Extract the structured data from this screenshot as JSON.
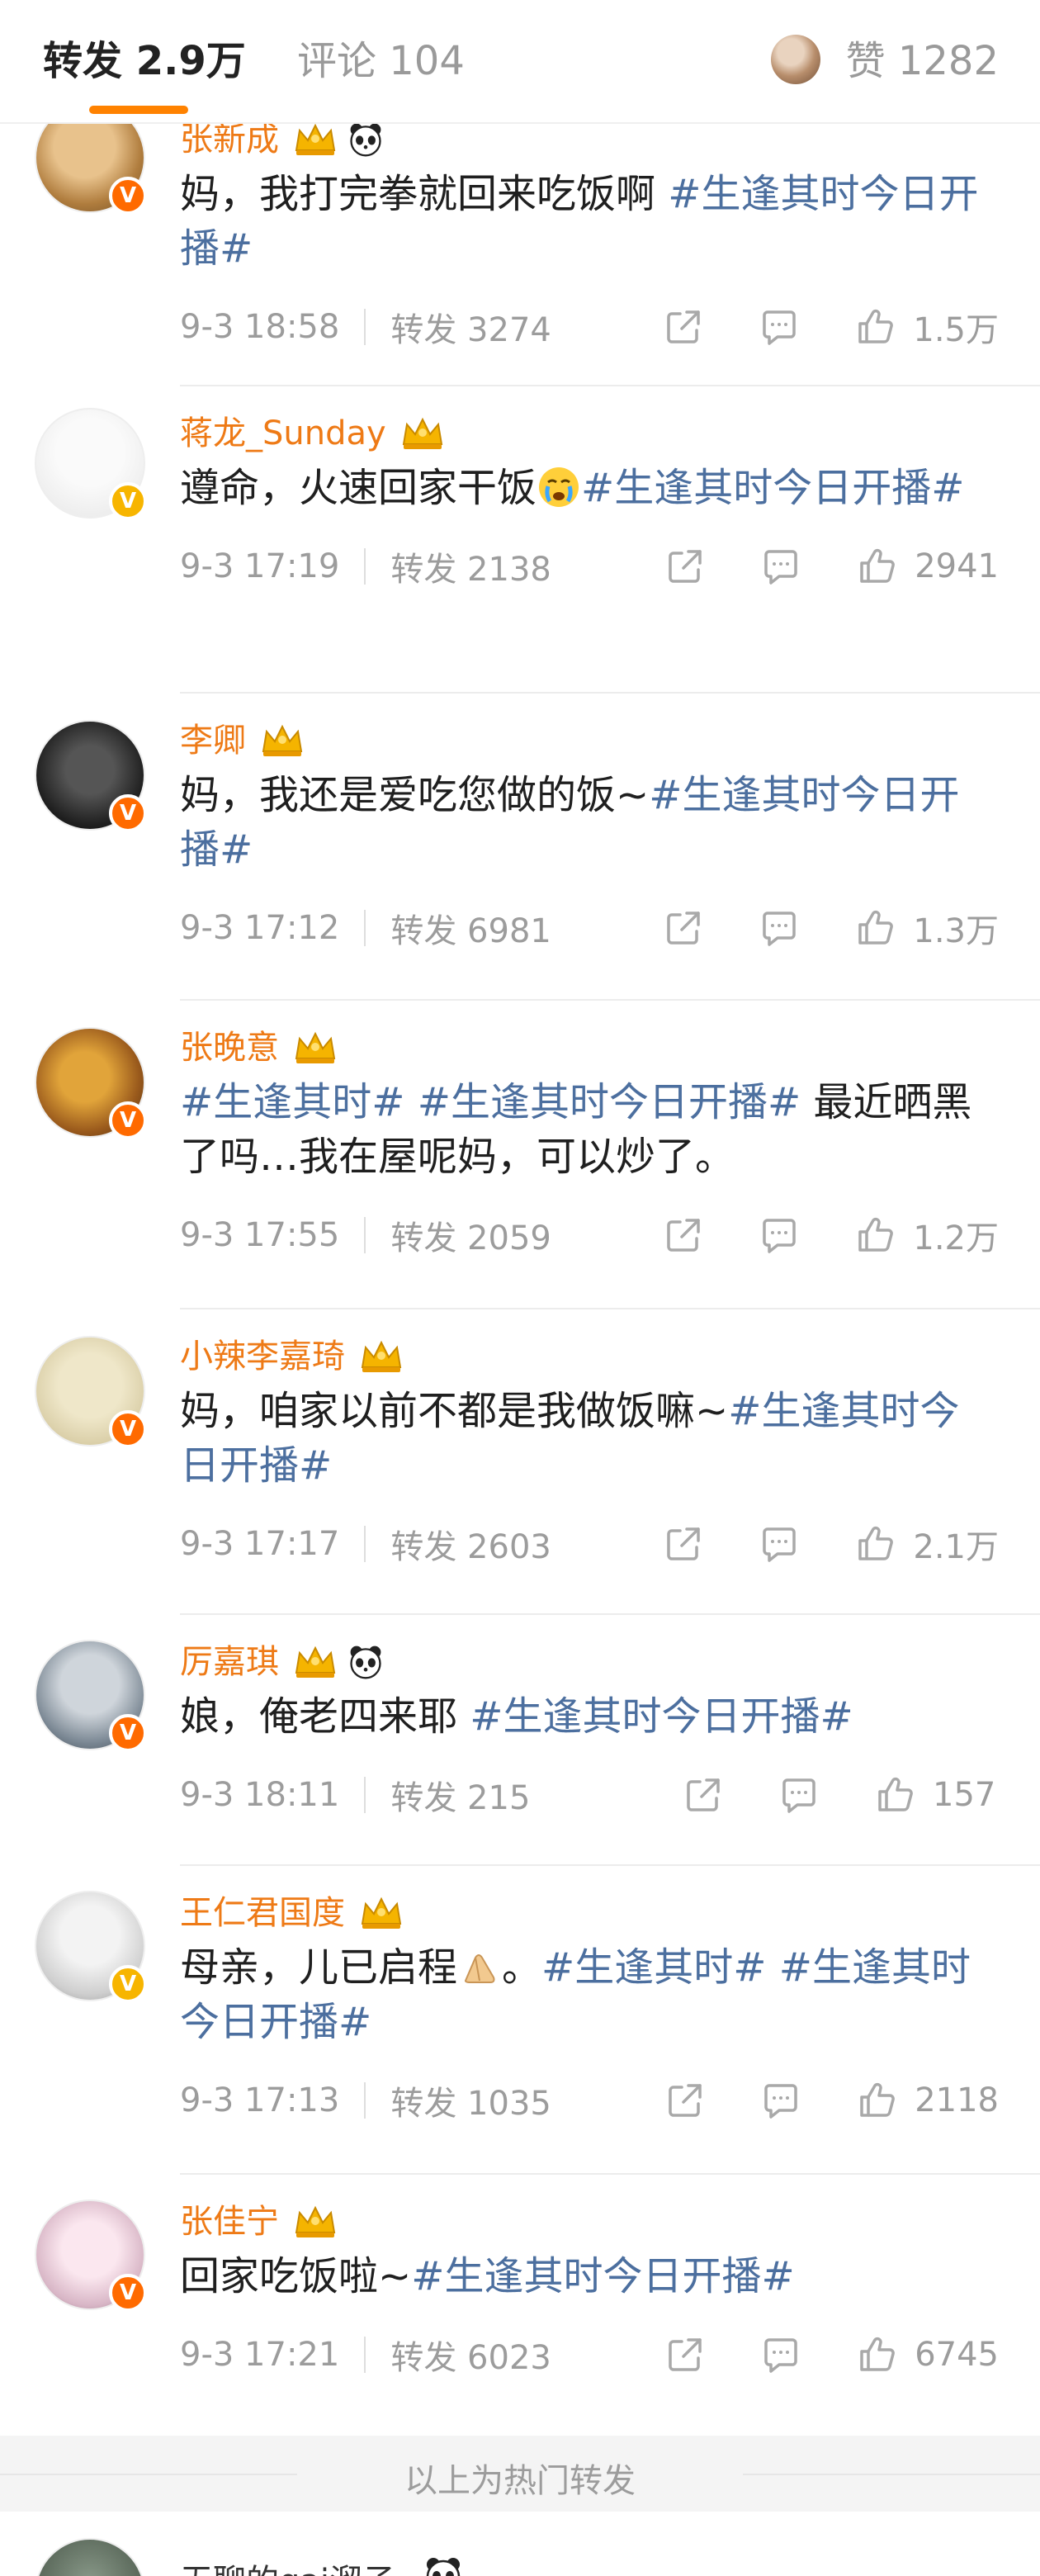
{
  "tabs": {
    "repost": "转发 2.9万",
    "comments": "评论 104",
    "likes": "赞 1282"
  },
  "posts": [
    {
      "name": "张新成",
      "badge": "V",
      "crown": "♛",
      "panda": true,
      "text": "妈，我打完拳就回来吃饭啊 ",
      "tags": [
        "#生逢其时今日开播#"
      ],
      "time": "9-3 18:58",
      "reposts": "转发 3274",
      "likes": "1.5万"
    },
    {
      "name": "蒋龙_Sunday",
      "badge": "V",
      "crown": "♛",
      "panda": false,
      "text": "遵命，火速回家干饭",
      "emoji": "crying-face",
      "tags": [
        "#生逢其时今日开播#"
      ],
      "time": "9-3 17:19",
      "reposts": "转发 2138",
      "likes": "2941"
    },
    {
      "name": "李卿",
      "badge": "V",
      "crown": "♛",
      "panda": false,
      "text": "妈，我还是爱吃您做的饭~",
      "tags": [
        "#生逢其时今日开播#"
      ],
      "time": "9-3 17:12",
      "reposts": "转发 6981",
      "likes": "1.3万"
    },
    {
      "name": "张晚意",
      "badge": "V",
      "crown": "♛",
      "panda": false,
      "text_pre_tags": [
        "#生逢其时#",
        "#生逢其时今日开播#"
      ],
      "text": " 最近晒黑了吗…我在屋呢妈，可以炒了。",
      "time": "9-3 17:55",
      "reposts": "转发 2059",
      "likes": "1.2万"
    },
    {
      "name": "小辣李嘉琦",
      "badge": "V",
      "crown": "♛",
      "panda": false,
      "text": "妈，咱家以前不都是我做饭嘛~",
      "tags": [
        "#生逢其时今日开播#"
      ],
      "time": "9-3 17:17",
      "reposts": "转发 2603",
      "likes": "2.1万"
    },
    {
      "name": "厉嘉琪",
      "badge": "V",
      "crown": "♛",
      "panda": true,
      "text": "娘，俺老四来耶 ",
      "tags": [
        "#生逢其时今日开播#"
      ],
      "time": "9-3 18:11",
      "reposts": "转发 215",
      "likes": "157"
    },
    {
      "name": "王仁君国度",
      "badge": "V",
      "crown": "♛",
      "panda": false,
      "text": "母亲，儿已启程",
      "emoji": "folded-hands",
      "text_after_emoji": "。",
      "tags": [
        "#生逢其时#",
        "#生逢其时今日开播#"
      ],
      "time": "9-3 17:13",
      "reposts": "转发 1035",
      "likes": "2118"
    },
    {
      "name": "张佳宁",
      "badge": "V",
      "crown": "♛",
      "panda": false,
      "text": "回家吃饭啦~",
      "tags": [
        "#生逢其时今日开播#"
      ],
      "time": "9-3 17:21",
      "reposts": "转发 6023",
      "likes": "6745"
    }
  ],
  "footer": {
    "hot_label": "以上为热门转发"
  },
  "partial": {
    "name": "无聊的gai溜子"
  },
  "colors": {
    "accent": "#ff8200",
    "name": "#ee7a16",
    "hashtag": "#4c6f9f",
    "meta": "#9c9c9c"
  }
}
